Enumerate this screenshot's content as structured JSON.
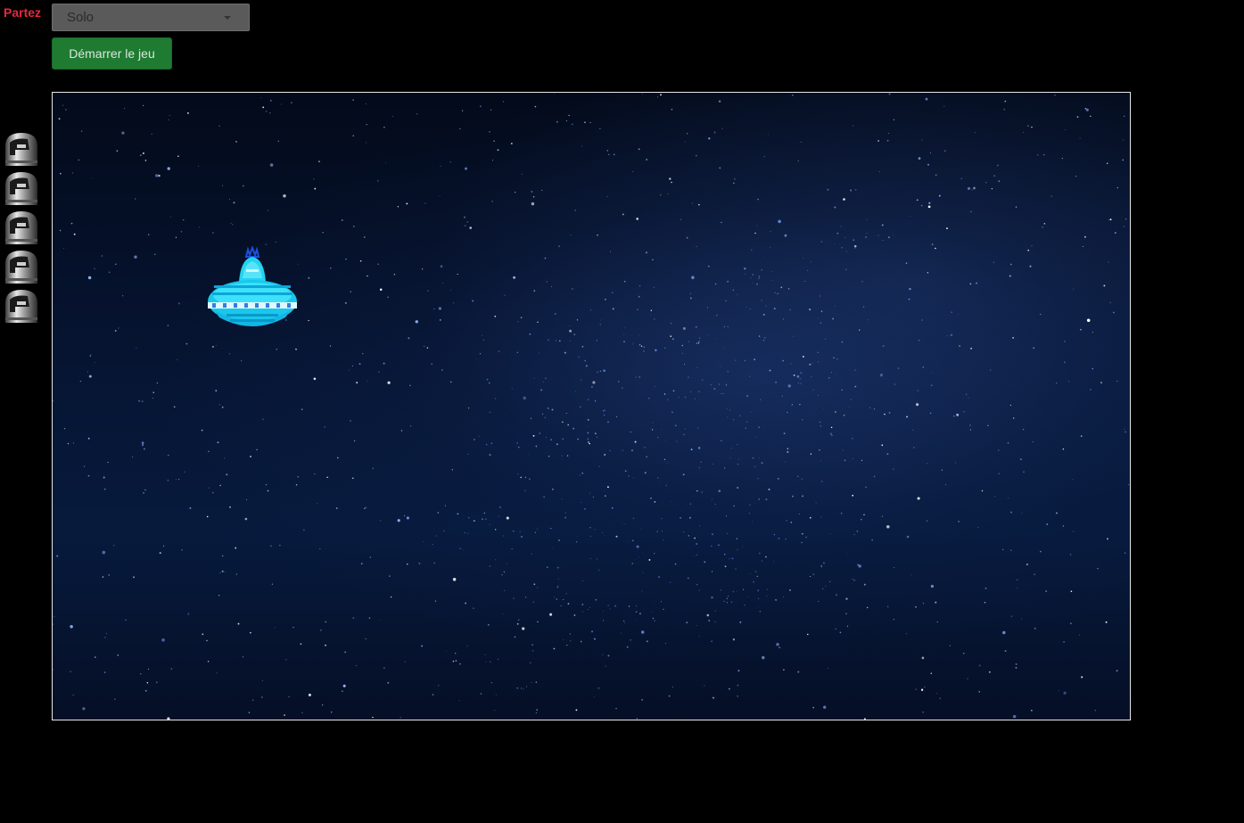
{
  "header": {
    "title_label": "Partez"
  },
  "mode_select": {
    "selected": "Solo"
  },
  "start_button": {
    "label": "Démarrer le jeu"
  },
  "lives": {
    "count": 5,
    "icon": "helmet-icon"
  },
  "game": {
    "player_icon": "ufo-icon",
    "background": "starfield",
    "colors": {
      "border": "#e8e8e8",
      "ufo": "#18d8f0",
      "start_button": "#1f7a32",
      "title": "#e8283c"
    }
  }
}
